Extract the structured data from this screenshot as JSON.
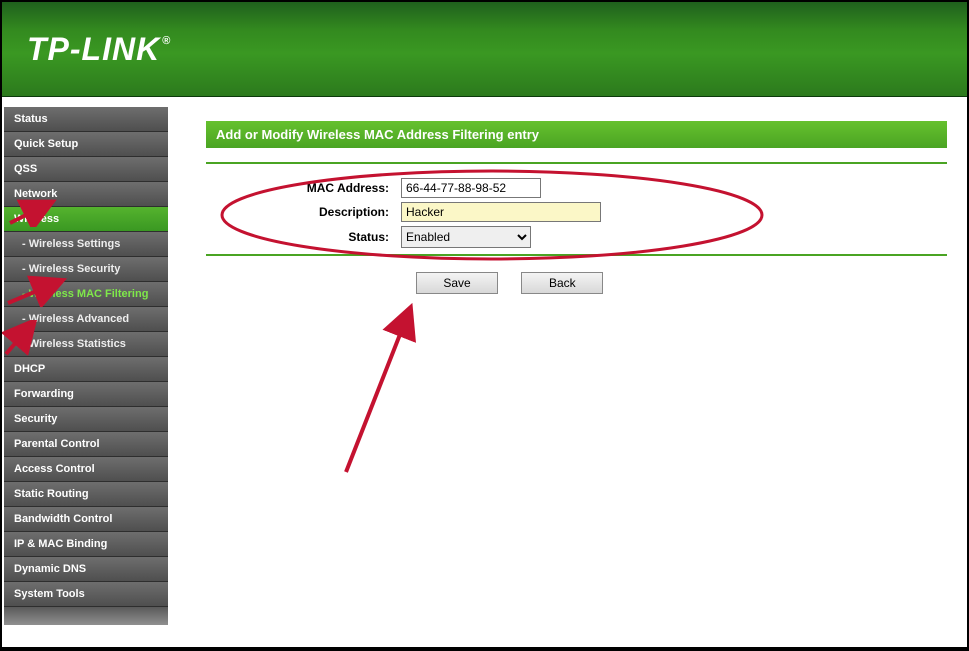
{
  "brand": "TP-LINK",
  "sidebar": {
    "items": [
      {
        "label": "Status"
      },
      {
        "label": "Quick Setup"
      },
      {
        "label": "QSS"
      },
      {
        "label": "Network"
      },
      {
        "label": "Wireless",
        "active": true
      },
      {
        "label": "- Wireless Settings",
        "sub": true
      },
      {
        "label": "- Wireless Security",
        "sub": true
      },
      {
        "label": "- Wireless MAC Filtering",
        "sub": true,
        "activeSub": true
      },
      {
        "label": "- Wireless Advanced",
        "sub": true
      },
      {
        "label": "- Wireless Statistics",
        "sub": true
      },
      {
        "label": "DHCP"
      },
      {
        "label": "Forwarding"
      },
      {
        "label": "Security"
      },
      {
        "label": "Parental Control"
      },
      {
        "label": "Access Control"
      },
      {
        "label": "Static Routing"
      },
      {
        "label": "Bandwidth Control"
      },
      {
        "label": "IP & MAC Binding"
      },
      {
        "label": "Dynamic DNS"
      },
      {
        "label": "System Tools"
      }
    ]
  },
  "page": {
    "title": "Add or Modify Wireless MAC Address Filtering entry",
    "labels": {
      "mac": "MAC Address:",
      "desc": "Description:",
      "status": "Status:"
    },
    "values": {
      "mac": "66-44-77-88-98-52",
      "desc": "Hacker",
      "status": "Enabled"
    },
    "buttons": {
      "save": "Save",
      "back": "Back"
    }
  }
}
